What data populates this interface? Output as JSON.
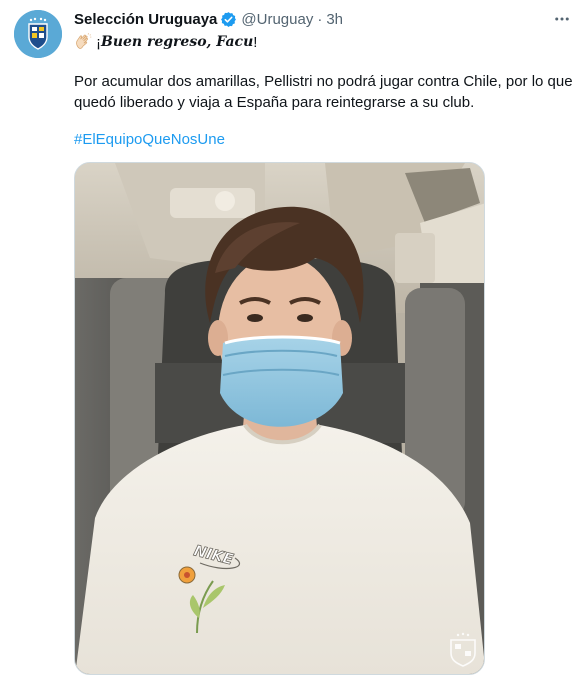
{
  "account": {
    "display_name": "Selección Uruguaya",
    "handle": "@Uruguay",
    "separator": "·",
    "time": "3h",
    "verified": true,
    "avatar_icon": "auf-crest-icon"
  },
  "tweet": {
    "line1_prefix": "¡",
    "line1_emphasis": "Buen regreso, Facu",
    "line1_suffix": "!",
    "emoji_icon": "clapping-hands-icon",
    "body": "Por acumular dos amarillas, Pellistri no podrá jugar contra Chile, por lo que quedó liberado y viaja a España para reintegrarse a su club.",
    "hashtag": "#ElEquipoQueNosUne"
  },
  "media": {
    "shirt_logo": "NIKE",
    "watermark_icon": "auf-crest-watermark-icon"
  },
  "colors": {
    "link": "#1d9bf0",
    "verified": "#1d9bf0",
    "secondary_text": "#536471",
    "avatar_bg": "#5aa9d6"
  }
}
